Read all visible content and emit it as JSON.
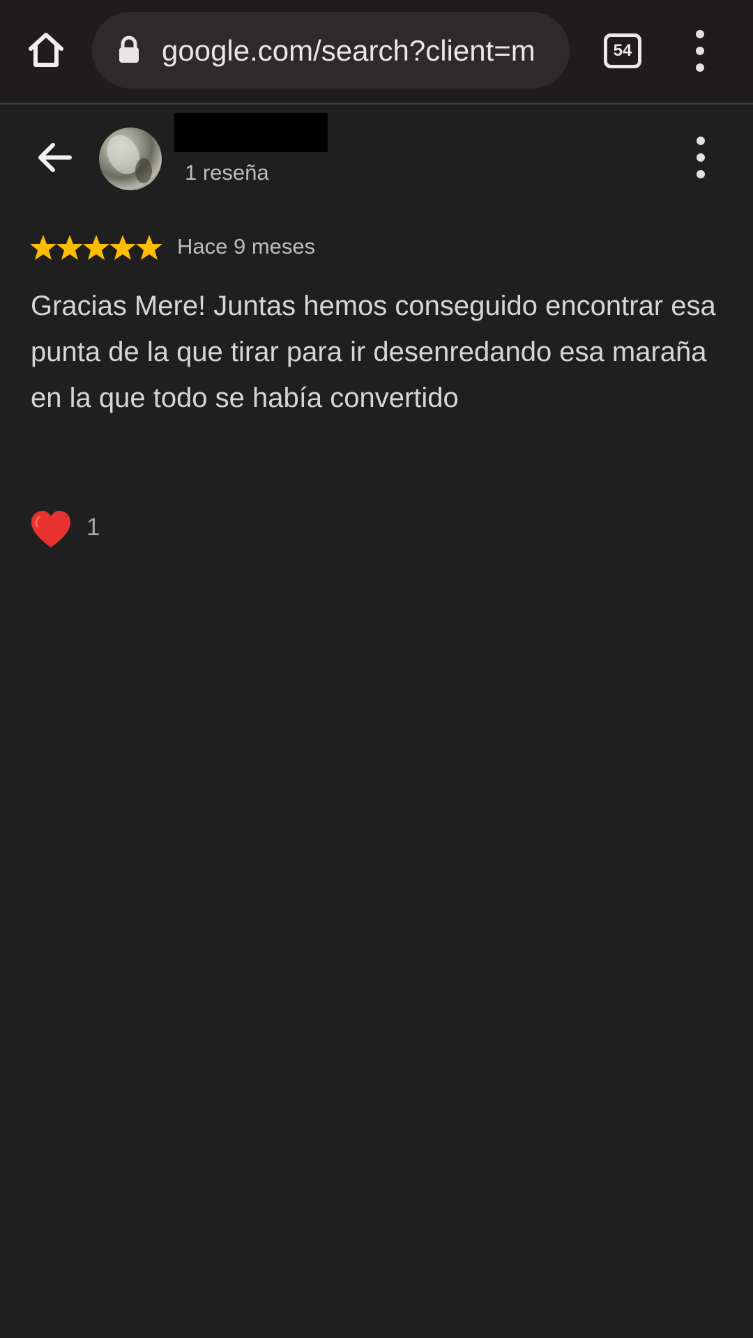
{
  "browser": {
    "url": "google.com/search?client=m",
    "tab_count": "54",
    "icons": {
      "home": "home-icon",
      "lock": "lock-icon",
      "tabs": "tabs-icon",
      "menu": "more-vert-icon"
    },
    "colors": {
      "toolbar_bg": "#1f1c1d",
      "url_pill_bg": "#2e292b",
      "url_text": "#e9e6e7"
    }
  },
  "review_header": {
    "review_count": "1 reseña",
    "icons": {
      "back": "arrow-back-icon",
      "avatar": "avatar-image",
      "menu": "more-vert-icon"
    }
  },
  "review": {
    "rating": 5,
    "date": "Hace 9 meses",
    "text": "Gracias Mere! Juntas hemos conseguido encontrar esa punta de la que tirar para ir desenredando esa maraña en la que todo se había convertido",
    "reactions": {
      "icon": "heart-icon",
      "count": "1"
    }
  },
  "colors": {
    "page_bg": "#1f1f1f",
    "star": "#fbbc04",
    "heart": "#e8322f",
    "body_text": "#d6d6d6",
    "secondary_text": "#bdbdbd"
  }
}
